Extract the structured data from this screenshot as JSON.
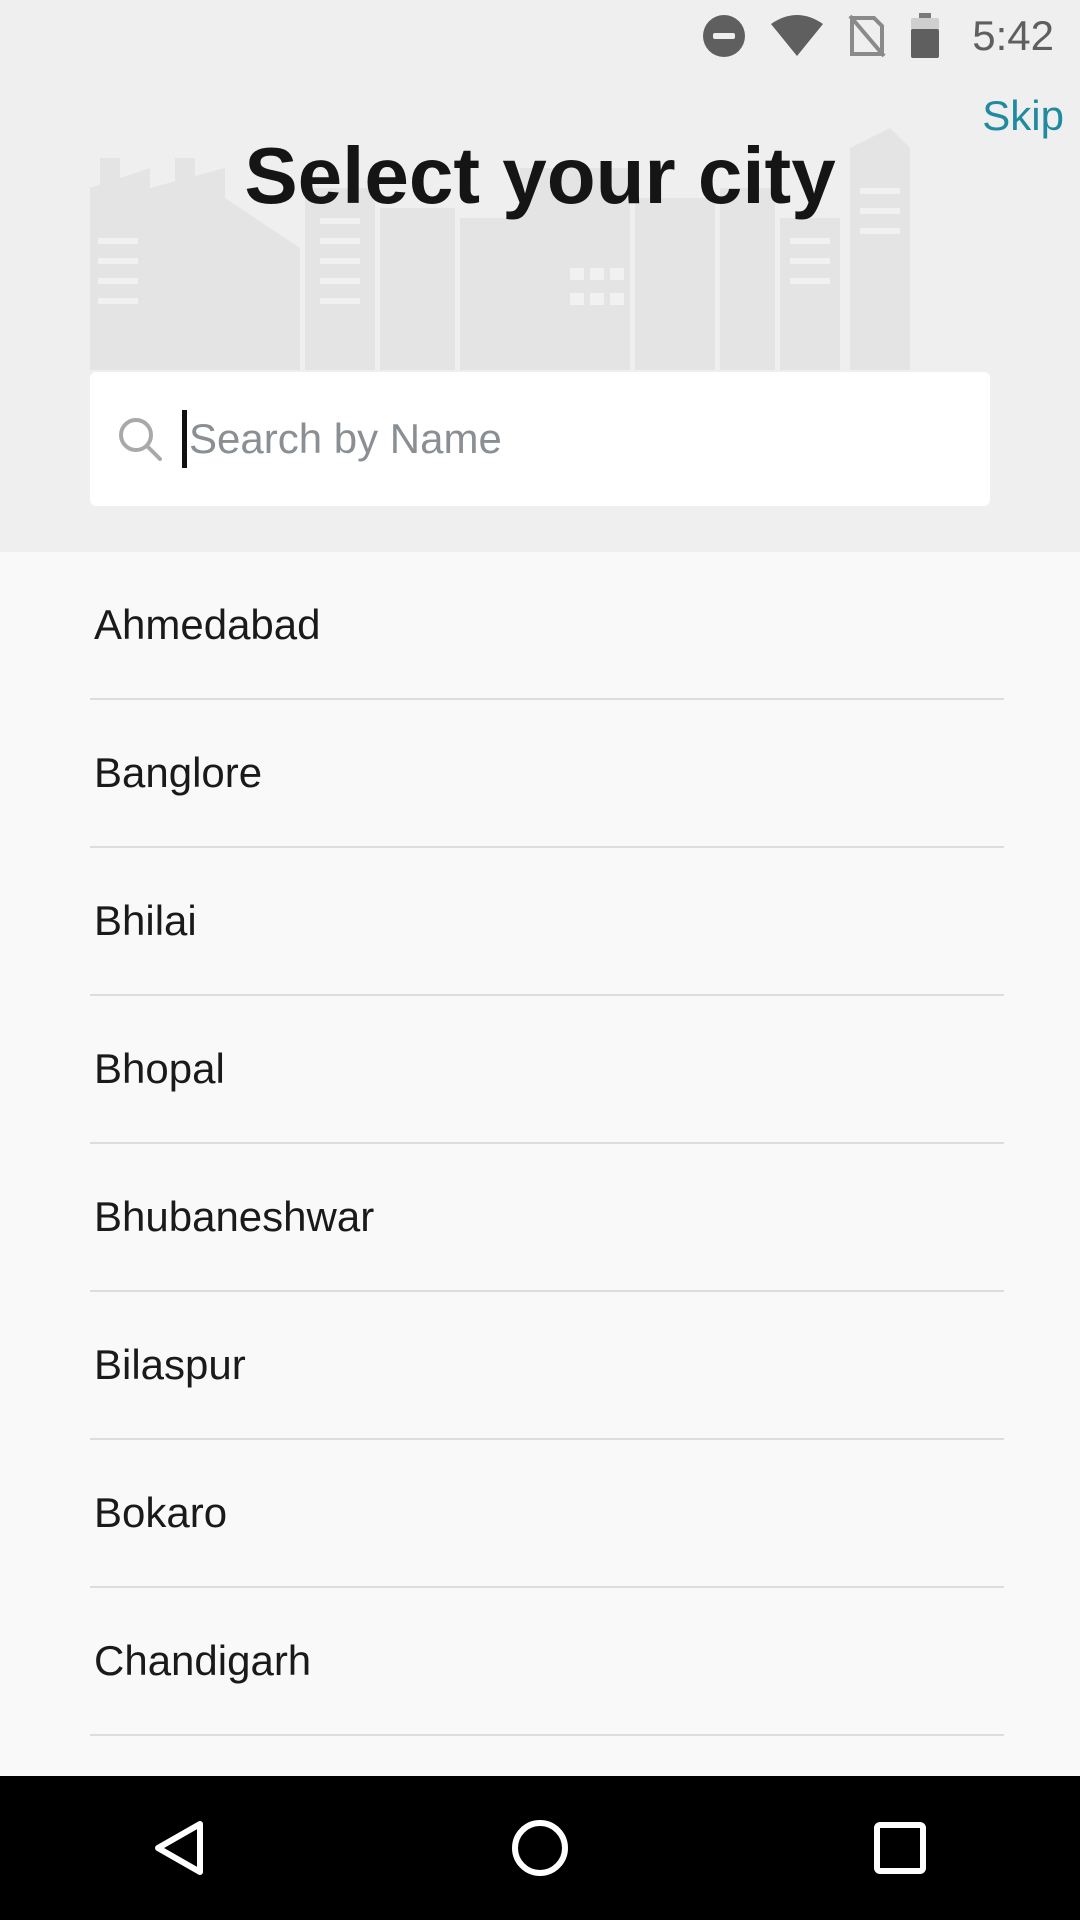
{
  "status_bar": {
    "icons": [
      "do-not-disturb-icon",
      "wifi-icon",
      "no-sim-icon",
      "battery-icon"
    ],
    "time": "5:42"
  },
  "header": {
    "skip_label": "Skip",
    "title": "Select your city",
    "background_icon": "city-skyline-icon"
  },
  "search": {
    "placeholder": "Search by Name",
    "value": "",
    "icon": "search-icon"
  },
  "cities": [
    {
      "label": "Ahmedabad"
    },
    {
      "label": "Banglore"
    },
    {
      "label": "Bhilai"
    },
    {
      "label": "Bhopal"
    },
    {
      "label": "Bhubaneshwar"
    },
    {
      "label": "Bilaspur"
    },
    {
      "label": "Bokaro"
    },
    {
      "label": "Chandigarh"
    }
  ],
  "nav_bar": {
    "icons": [
      "back-icon",
      "home-icon",
      "recents-icon"
    ]
  },
  "colors": {
    "accent": "#1f8aa0",
    "header_bg": "#efefef",
    "list_bg": "#f9f9f9",
    "nav_bg": "#000000"
  }
}
